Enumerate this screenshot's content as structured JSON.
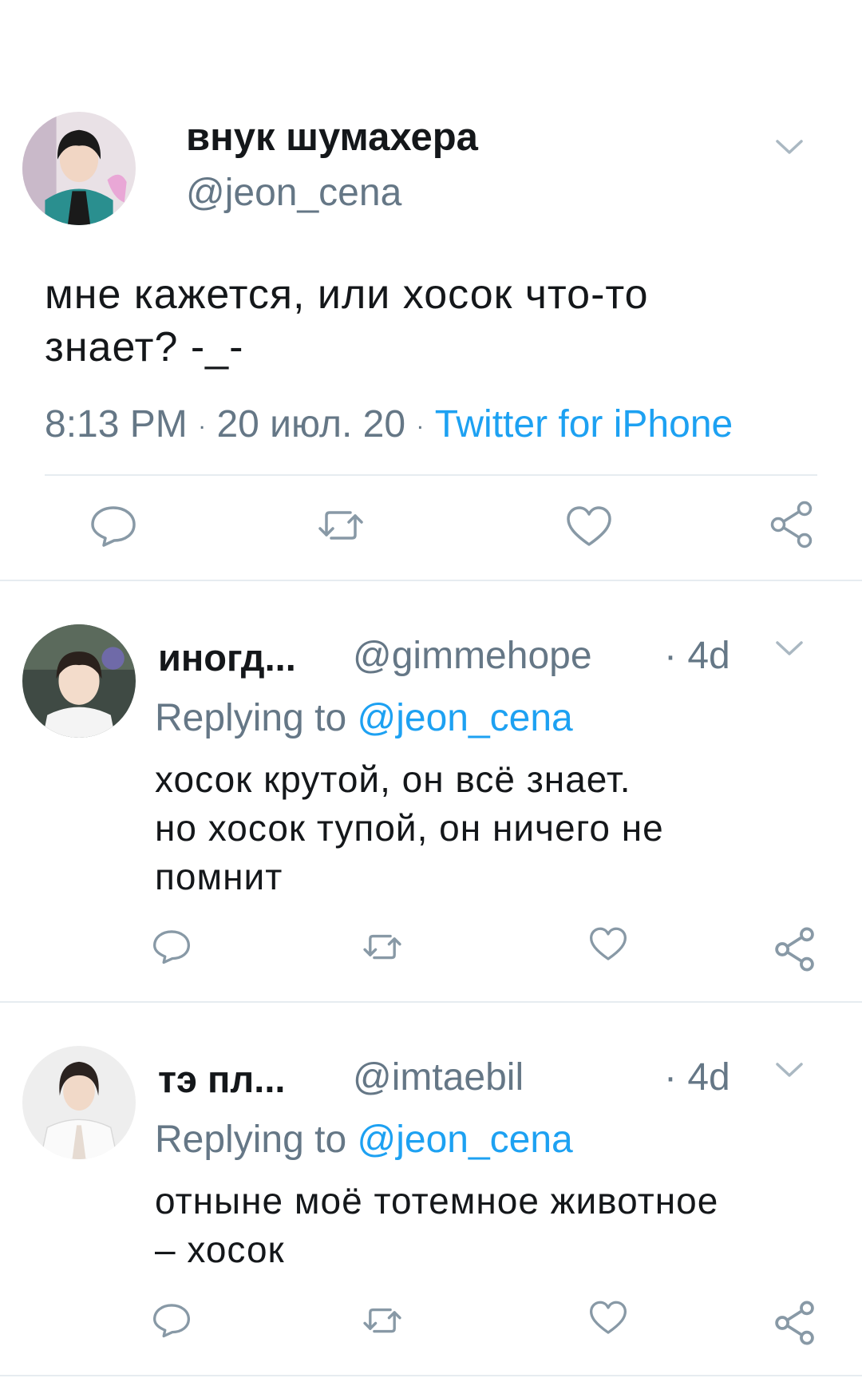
{
  "main_tweet": {
    "display_name": "внук шумахера",
    "handle": "@jeon_cena",
    "text": "мне кажется, или хосок что-то\nзнает? -_-",
    "time": "8:13 PM",
    "dot1": "·",
    "date": "20 июл. 20",
    "dot2": "·",
    "source": "Twitter for iPhone"
  },
  "replies": [
    {
      "display_name": "иногд...",
      "handle": "@gimmehope",
      "age": "· 4d",
      "replying_label": "Replying to",
      "replying_to": "@jeon_cena",
      "text": "хосок крутой, он всё знает.\nно хосок тупой, он ничего не\nпомнит"
    },
    {
      "display_name": "тэ пл...",
      "handle": "@imtaebil",
      "age": "· 4d",
      "replying_label": "Replying to",
      "replying_to": "@jeon_cena",
      "text": "отныне моё тотемное животное\n– хосок"
    }
  ],
  "icons": {
    "reply": "speech-bubble-icon",
    "retweet": "retweet-icon",
    "like": "heart-icon",
    "share": "share-icon",
    "more": "chevron-down-icon"
  },
  "colors": {
    "link": "#1da1f2",
    "secondary_text": "#657786",
    "icon": "#8899a6",
    "divider": "#e6ecf0"
  }
}
